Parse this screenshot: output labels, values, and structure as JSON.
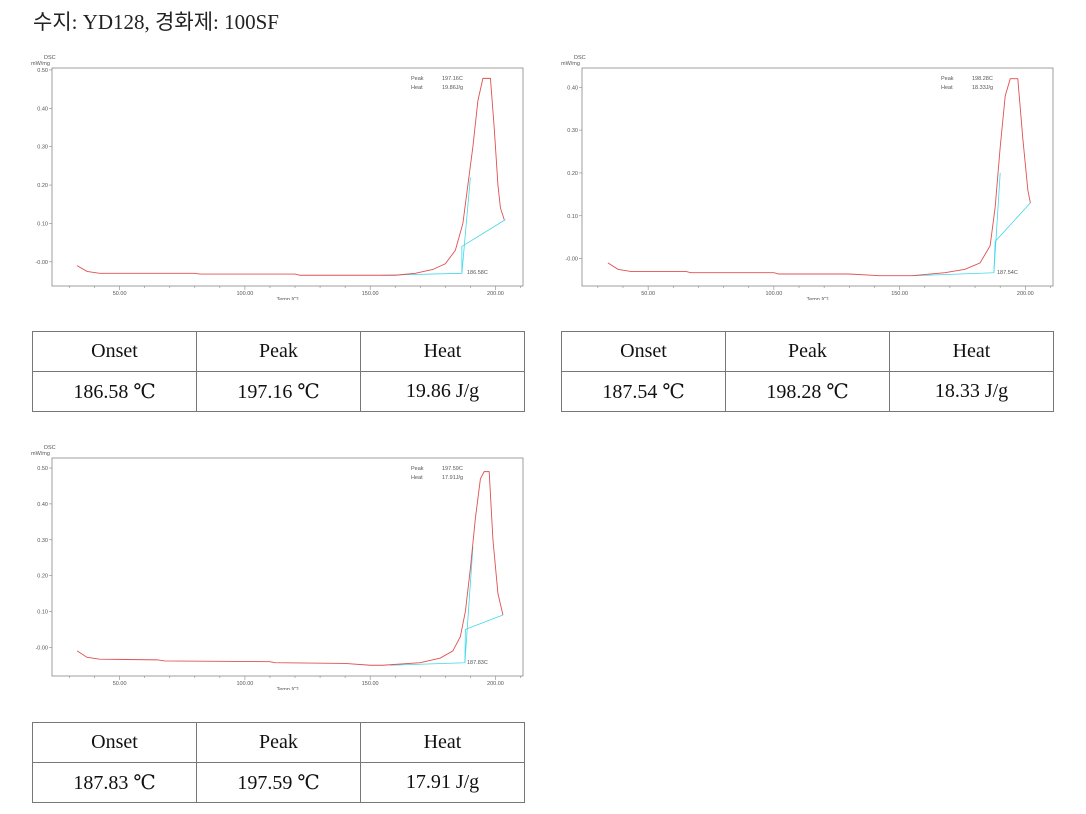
{
  "title": "수지: YD128, 경화제: 100SF",
  "chart_data": [
    {
      "type": "line",
      "ylabel_top": "DSC",
      "ylabel_unit": "mW/mg",
      "xlabel": "Temp [C]",
      "xlim": [
        23,
        211
      ],
      "ylim": [
        -0.063,
        0.505
      ],
      "xticks": [
        50,
        100,
        150,
        200
      ],
      "xtick_labels": [
        "50.00",
        "100.00",
        "150.00",
        "200.00"
      ],
      "yticks": [
        0,
        0.1,
        0.2,
        0.3,
        0.4,
        0.5
      ],
      "ytick_labels": [
        "-0.00",
        "0.10",
        "0.20",
        "0.30",
        "0.40",
        "0.50"
      ],
      "annotation": {
        "peak_label": "Peak",
        "peak_value": "197.16C",
        "heat_label": "Heat",
        "heat_value": "19.86J/g",
        "onset_value": "186.58C"
      },
      "series": [
        {
          "color": "#e05050",
          "points": [
            [
              33,
              -0.01
            ],
            [
              37,
              -0.025
            ],
            [
              42,
              -0.03
            ],
            [
              80,
              -0.03
            ],
            [
              82,
              -0.032
            ],
            [
              120,
              -0.032
            ],
            [
              122,
              -0.035
            ],
            [
              160,
              -0.035
            ],
            [
              168,
              -0.03
            ],
            [
              175,
              -0.02
            ],
            [
              180,
              -0.005
            ],
            [
              184,
              0.03
            ],
            [
              187,
              0.1
            ],
            [
              189,
              0.2
            ],
            [
              191,
              0.3
            ],
            [
              193,
              0.42
            ],
            [
              195,
              0.478
            ],
            [
              198,
              0.478
            ],
            [
              199.5,
              0.35
            ],
            [
              201,
              0.2
            ],
            [
              202,
              0.14
            ],
            [
              203.5,
              0.11
            ]
          ]
        }
      ],
      "baseline": {
        "color": "#40d8e8",
        "segments": [
          [
            [
              155,
              -0.035
            ],
            [
              186.6,
              -0.03
            ],
            [
              186.6,
              0.04
            ],
            [
              204,
              0.11
            ]
          ],
          [
            [
              186.6,
              -0.03
            ],
            [
              190,
              0.22
            ]
          ]
        ]
      }
    },
    {
      "type": "line",
      "ylabel_top": "DSC",
      "ylabel_unit": "mW/mg",
      "xlabel": "Temp [C]",
      "xlim": [
        23.7,
        211
      ],
      "ylim": [
        -0.064,
        0.445
      ],
      "xticks": [
        50,
        100,
        150,
        200
      ],
      "xtick_labels": [
        "50.00",
        "100.00",
        "150.00",
        "200.00"
      ],
      "yticks": [
        0,
        0.1,
        0.2,
        0.3,
        0.4
      ],
      "ytick_labels": [
        "-0.00",
        "0.10",
        "0.20",
        "0.30",
        "0.40"
      ],
      "annotation": {
        "peak_label": "Peak",
        "peak_value": "198.28C",
        "heat_label": "Heat",
        "heat_value": "18.33J/g",
        "onset_value": "187.54C"
      },
      "series": [
        {
          "color": "#e05050",
          "points": [
            [
              34,
              -0.01
            ],
            [
              38,
              -0.025
            ],
            [
              43,
              -0.03
            ],
            [
              65,
              -0.03
            ],
            [
              67,
              -0.033
            ],
            [
              100,
              -0.033
            ],
            [
              102,
              -0.036
            ],
            [
              130,
              -0.036
            ],
            [
              142,
              -0.04
            ],
            [
              155,
              -0.04
            ],
            [
              168,
              -0.033
            ],
            [
              176,
              -0.025
            ],
            [
              182,
              -0.01
            ],
            [
              186,
              0.03
            ],
            [
              188,
              0.12
            ],
            [
              190,
              0.26
            ],
            [
              192,
              0.38
            ],
            [
              194,
              0.42
            ],
            [
              197,
              0.42
            ],
            [
              199,
              0.28
            ],
            [
              201,
              0.16
            ],
            [
              202,
              0.13
            ]
          ]
        }
      ],
      "baseline": {
        "color": "#40d8e8",
        "segments": [
          [
            [
              155,
              -0.04
            ],
            [
              187.5,
              -0.033
            ],
            [
              188,
              0.04
            ],
            [
              202,
              0.13
            ]
          ],
          [
            [
              187.5,
              -0.033
            ],
            [
              190,
              0.2
            ]
          ]
        ]
      }
    },
    {
      "type": "line",
      "ylabel_top": "DSC",
      "ylabel_unit": "mW/mg",
      "xlabel": "Temp [C]",
      "xlim": [
        23,
        211
      ],
      "ylim": [
        -0.08,
        0.528
      ],
      "xticks": [
        50,
        100,
        150,
        200
      ],
      "xtick_labels": [
        "50.00",
        "100.00",
        "150.00",
        "200.00"
      ],
      "yticks": [
        0,
        0.1,
        0.2,
        0.3,
        0.4,
        0.5
      ],
      "ytick_labels": [
        "-0.00",
        "0.10",
        "0.20",
        "0.30",
        "0.40",
        "0.50"
      ],
      "annotation": {
        "peak_label": "Peak",
        "peak_value": "197.59C",
        "heat_label": "Heat",
        "heat_value": "17.91J/g",
        "onset_value": "187.83C"
      },
      "series": [
        {
          "color": "#e05050",
          "points": [
            [
              33,
              -0.01
            ],
            [
              37,
              -0.028
            ],
            [
              42,
              -0.033
            ],
            [
              65,
              -0.035
            ],
            [
              68,
              -0.038
            ],
            [
              110,
              -0.04
            ],
            [
              112,
              -0.043
            ],
            [
              140,
              -0.045
            ],
            [
              150,
              -0.05
            ],
            [
              155,
              -0.05
            ],
            [
              170,
              -0.043
            ],
            [
              178,
              -0.03
            ],
            [
              183,
              -0.01
            ],
            [
              186,
              0.03
            ],
            [
              188,
              0.1
            ],
            [
              190,
              0.22
            ],
            [
              192,
              0.36
            ],
            [
              194,
              0.47
            ],
            [
              195.5,
              0.49
            ],
            [
              197.5,
              0.49
            ],
            [
              199,
              0.3
            ],
            [
              201,
              0.15
            ],
            [
              203,
              0.09
            ]
          ]
        }
      ],
      "baseline": {
        "color": "#40d8e8",
        "segments": [
          [
            [
              158,
              -0.05
            ],
            [
              187.8,
              -0.043
            ],
            [
              188,
              0.05
            ],
            [
              203,
              0.09
            ]
          ],
          [
            [
              187.8,
              -0.043
            ],
            [
              191,
              0.28
            ]
          ]
        ]
      }
    }
  ],
  "tables": [
    {
      "headers": [
        "Onset",
        "Peak",
        "Heat"
      ],
      "values": [
        "186.58 ℃",
        "197.16 ℃",
        "19.86 J/g"
      ]
    },
    {
      "headers": [
        "Onset",
        "Peak",
        "Heat"
      ],
      "values": [
        "187.54 ℃",
        "198.28 ℃",
        "18.33 J/g"
      ]
    },
    {
      "headers": [
        "Onset",
        "Peak",
        "Heat"
      ],
      "values": [
        "187.83 ℃",
        "197.59 ℃",
        "17.91 J/g"
      ]
    }
  ]
}
